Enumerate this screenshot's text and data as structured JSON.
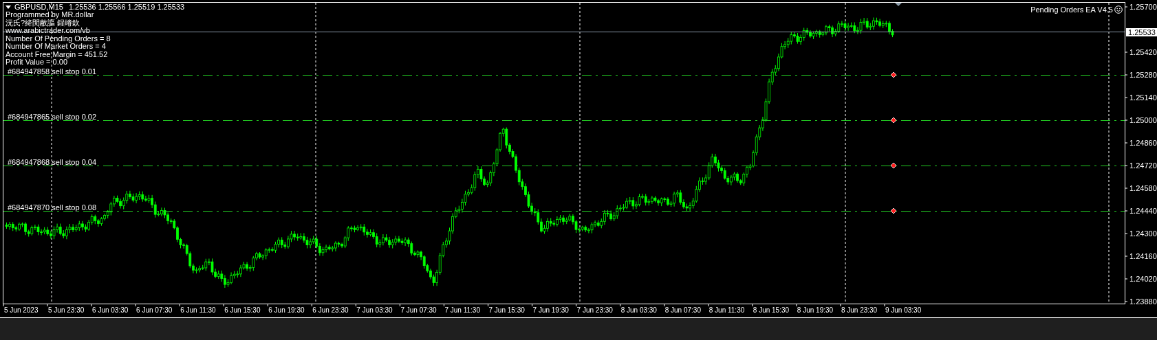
{
  "chart": {
    "symbol": "GBPUSD,M15",
    "quotes": "1.25536 1.25566 1.25519 1.25533",
    "info_lines": [
      "Programmed by MR.dollar",
      "沅氏?絳閔敝謳 鍟嵴欽",
      "www.arabictrader.com/vb",
      "Number Of Pending Orders = 8",
      "Number Of Market Orders = 4",
      "Account Free Margin = 451.52",
      "Profit Value = 0.00"
    ],
    "expert_label": "Pending Orders EA V4.5",
    "bid_price": "1.25533",
    "price_ticks": [
      {
        "label": "1.25700"
      },
      {
        "label": "1.25420"
      },
      {
        "label": "1.25280",
        "order": {
          "label": "#684947858 sell stop 0.01"
        }
      },
      {
        "label": "1.25140"
      },
      {
        "label": "1.25000",
        "order": {
          "label": "#684947865 sell stop 0.02"
        }
      },
      {
        "label": "1.24860"
      },
      {
        "label": "1.24720",
        "order": {
          "label": "#684947868 sell stop 0.04"
        }
      },
      {
        "label": "1.24580"
      },
      {
        "label": "1.24440",
        "order": {
          "label": "#684947870 sell stop 0.08"
        }
      },
      {
        "label": "1.24300"
      },
      {
        "label": "1.24160"
      },
      {
        "label": "1.24020"
      },
      {
        "label": "1.23880"
      }
    ],
    "time_labels": [
      "5 Jun 2023",
      "5 Jun 23:30",
      "6 Jun 03:30",
      "6 Jun 07:30",
      "6 Jun 11:30",
      "6 Jun 15:30",
      "6 Jun 19:30",
      "6 Jun 23:30",
      "7 Jun 03:30",
      "7 Jun 07:30",
      "7 Jun 11:30",
      "7 Jun 15:30",
      "7 Jun 19:30",
      "7 Jun 23:30",
      "8 Jun 03:30",
      "8 Jun 07:30",
      "8 Jun 11:30",
      "8 Jun 15:30",
      "8 Jun 19:30",
      "8 Jun 23:30",
      "9 Jun 03:30"
    ]
  }
}
